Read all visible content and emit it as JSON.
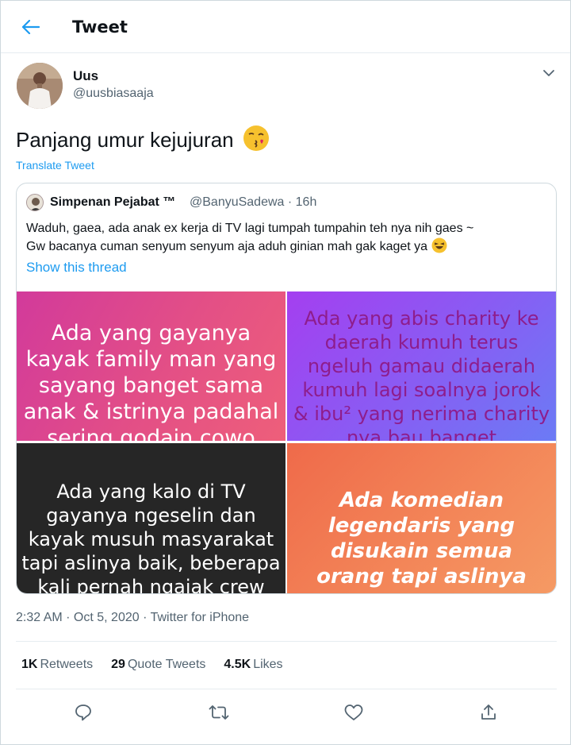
{
  "header": {
    "title": "Tweet"
  },
  "author": {
    "name": "Uus",
    "handle": "@uusbiasaaja"
  },
  "tweet": {
    "text": "Panjang umur kejujuran",
    "translate_label": "Translate Tweet"
  },
  "quote": {
    "name": "Simpenan Pejabat ™",
    "handle_time": "@BanyuSadewa · 16h",
    "line1": "Waduh, gaea, ada anak ex kerja di TV lagi tumpah tumpahin teh nya nih gaes ~",
    "line2": "Gw bacanya cuman senyum senyum aja aduh ginian mah gak kaget ya",
    "thread_label": "Show this thread",
    "images": [
      {
        "text": "Ada yang gayanya\nkayak family man yang\nsayang banget sama\nanak & istrinya padahal\nsering godain cowo"
      },
      {
        "text": "Ada yang abis charity ke\ndaerah kumuh terus\nngeluh gamau didaerah\nkumuh lagi soalnya jorok\n& ibu² yang nerima charity\nnya bau banget"
      },
      {
        "text": "Ada yang kalo di TV\ngayanya ngeselin dan\nkayak musuh masyarakat\ntapi aslinya baik, beberapa\nkali pernah ngajak crew"
      },
      {
        "text": "Ada komedian\nlegendaris yang\ndisukain semua\norang tapi aslinya"
      }
    ]
  },
  "meta": {
    "time_date": "2:32 AM · Oct 5, 2020 · ",
    "source": "Twitter for iPhone"
  },
  "stats": {
    "retweets_count": "1K",
    "retweets_label": "Retweets",
    "quotes_count": "29",
    "quotes_label": "Quote Tweets",
    "likes_count": "4.5K",
    "likes_label": "Likes"
  },
  "colors": {
    "accent": "#1d9bf0",
    "secondary_text": "#536471"
  },
  "icons": [
    "back-arrow-icon",
    "chevron-down-icon",
    "reply-icon",
    "retweet-icon",
    "like-icon",
    "share-icon"
  ]
}
